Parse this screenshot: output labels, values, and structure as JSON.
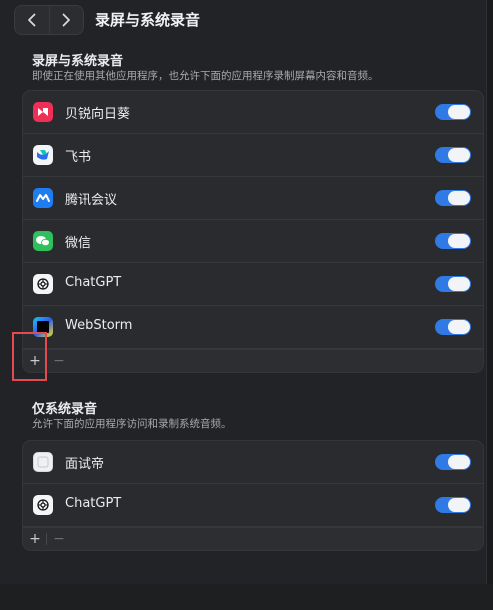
{
  "window": {
    "title": "录屏与系统录音"
  },
  "nav": {
    "back_icon": "chevron-left-icon",
    "forward_icon": "chevron-right-icon"
  },
  "screen_and_audio": {
    "title": "录屏与系统录音",
    "description": "即使正在使用其他应用程序，也允许下面的应用程序录制屏幕内容和音频。",
    "apps": [
      {
        "name": "贝锐向日葵",
        "enabled": true
      },
      {
        "name": "飞书",
        "enabled": true
      },
      {
        "name": "腾讯会议",
        "enabled": true
      },
      {
        "name": "微信",
        "enabled": true
      },
      {
        "name": "ChatGPT",
        "enabled": true
      },
      {
        "name": "WebStorm",
        "enabled": true
      }
    ],
    "add_label": "+",
    "remove_label": "−"
  },
  "audio_only": {
    "title": "仅系统录音",
    "description": "允许下面的应用程序访问和录制系统音频。",
    "apps": [
      {
        "name": "面试帝",
        "enabled": true
      },
      {
        "name": "ChatGPT",
        "enabled": true
      }
    ],
    "add_label": "+",
    "remove_label": "−"
  },
  "colors": {
    "accent": "#2f7ae5",
    "highlight": "#e34b4f"
  }
}
